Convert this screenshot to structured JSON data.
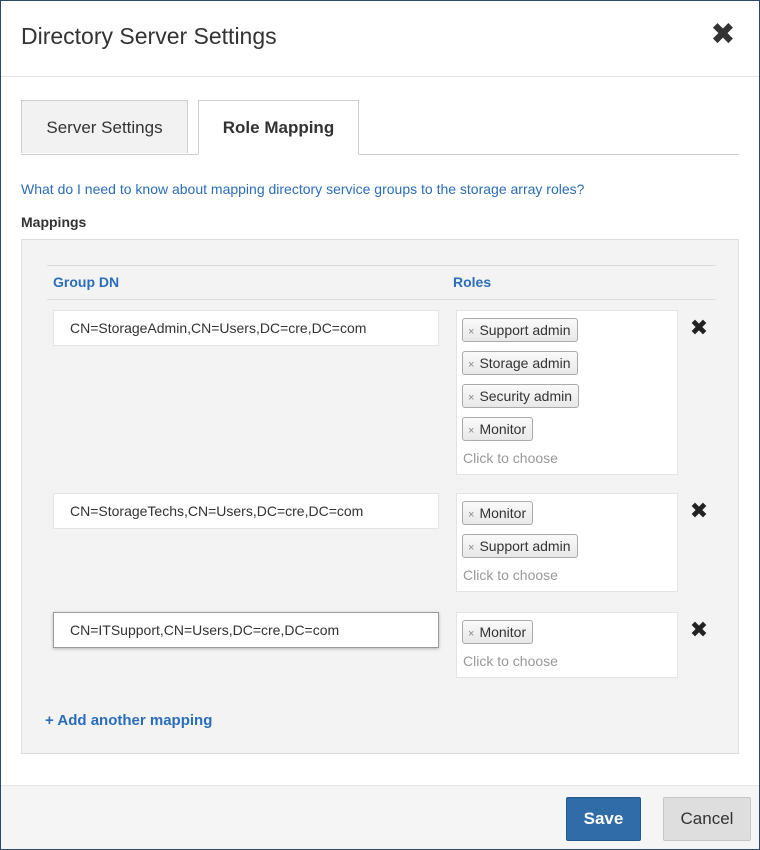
{
  "dialog": {
    "title": "Directory Server Settings",
    "close_glyph": "✖"
  },
  "tabs": [
    {
      "label": "Server Settings",
      "active": false
    },
    {
      "label": "Role Mapping",
      "active": true
    }
  ],
  "help_link": "What do I need to know about mapping directory service groups to the storage array roles?",
  "mappings_label": "Mappings",
  "columns": {
    "group_dn": "Group DN",
    "roles": "Roles"
  },
  "mappings": [
    {
      "group_dn": "CN=StorageAdmin,CN=Users,DC=cre,DC=com",
      "roles": [
        "Support admin",
        "Storage admin",
        "Security admin",
        "Monitor"
      ],
      "chooser": "Click to choose"
    },
    {
      "group_dn": "CN=StorageTechs,CN=Users,DC=cre,DC=com",
      "roles": [
        "Monitor",
        "Support admin"
      ],
      "chooser": "Click to choose"
    },
    {
      "group_dn": "CN=ITSupport,CN=Users,DC=cre,DC=com",
      "roles": [
        "Monitor"
      ],
      "chooser": "Click to choose"
    }
  ],
  "chip_remove_glyph": "×",
  "row_delete_glyph": "✖",
  "add_mapping": "+ Add another mapping",
  "footer": {
    "save": "Save",
    "cancel": "Cancel"
  },
  "colors": {
    "link": "#2a6ebb",
    "primary_button": "#2f6ca8",
    "panel_background": "#f3f3f3"
  }
}
